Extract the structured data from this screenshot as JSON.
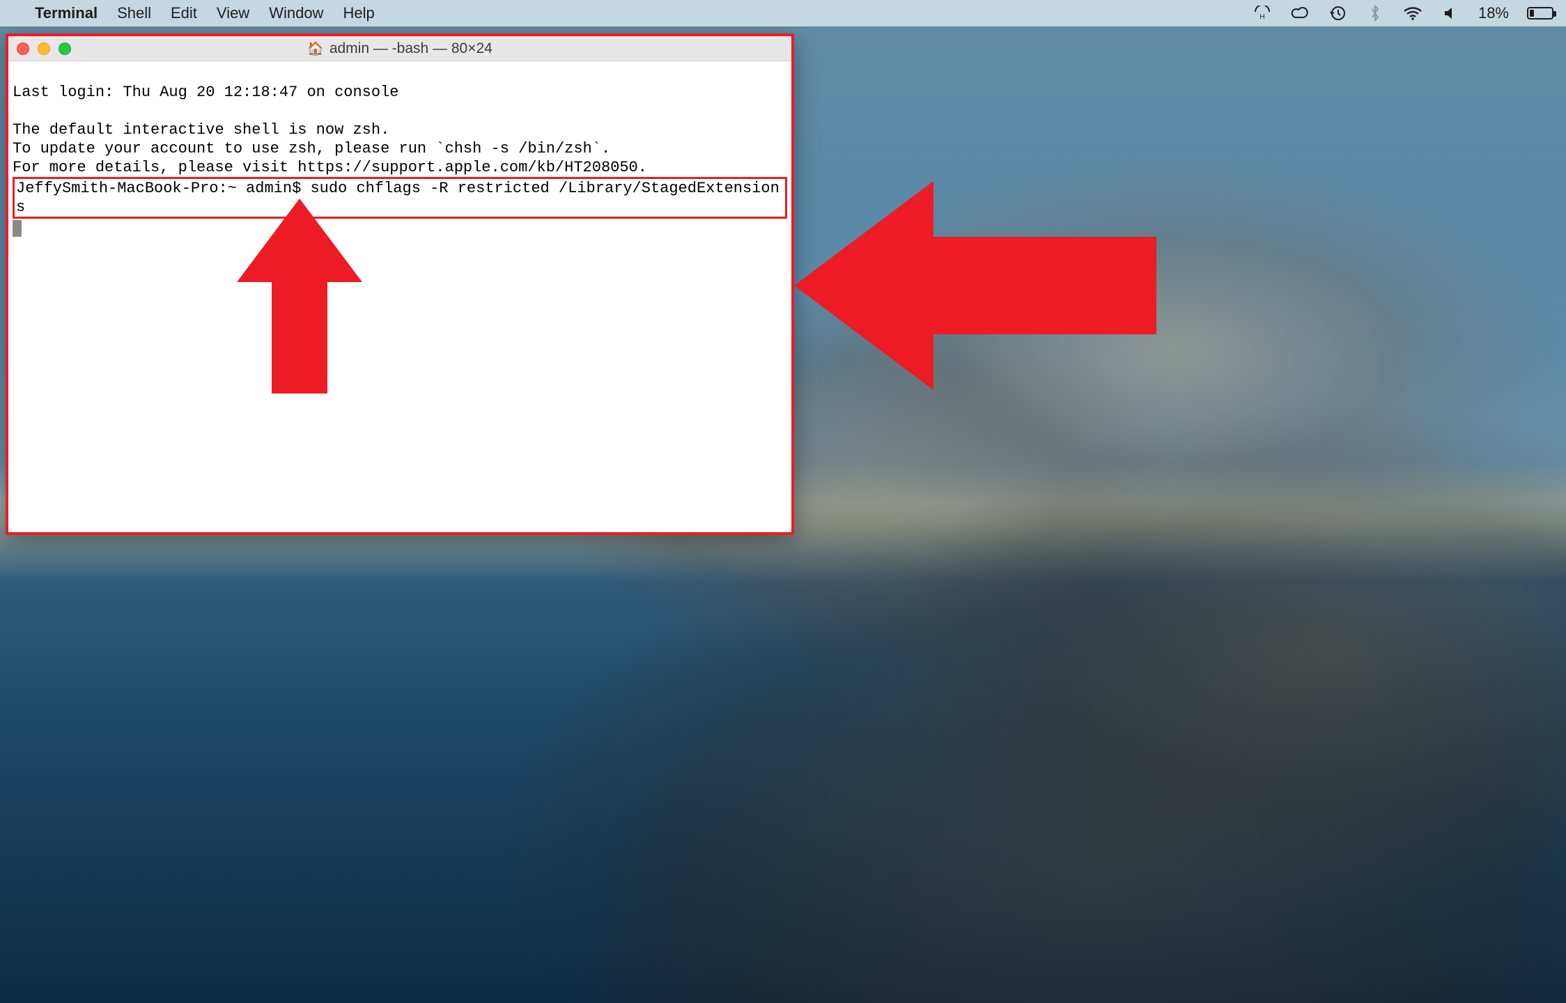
{
  "menubar": {
    "app_name": "Terminal",
    "menus": [
      "Shell",
      "Edit",
      "View",
      "Window",
      "Help"
    ],
    "battery_percent": "18%"
  },
  "terminal": {
    "title": "admin — -bash — 80×24",
    "lines": {
      "l0": "Last login: Thu Aug 20 12:18:47 on console",
      "l1": "",
      "l2": "The default interactive shell is now zsh.",
      "l3": "To update your account to use zsh, please run `chsh -s /bin/zsh`.",
      "l4": "For more details, please visit https://support.apple.com/kb/HT208050."
    },
    "prompt": "JeffySmith-MacBook-Pro:~ admin$ ",
    "command": "sudo chflags -R restricted /Library/StagedExtensions",
    "highlighted_command_full": "JeffySmith-MacBook-Pro:~ admin$ sudo chflags -R restricted /Library/StagedExtensions"
  },
  "annotation": {
    "color": "#ed1c24",
    "arrows": [
      "up-arrow-to-command",
      "left-arrow-to-terminal"
    ]
  }
}
